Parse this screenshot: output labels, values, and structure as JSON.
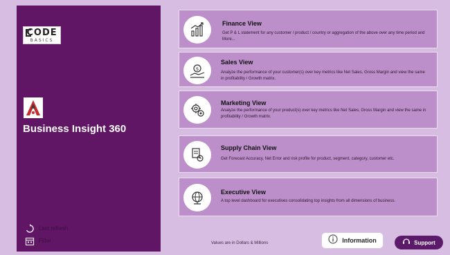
{
  "sidebar": {
    "brand_logo": {
      "top": "CODE",
      "bottom": "BASICS"
    },
    "app_title": "Business Insight 360",
    "rows": [
      {
        "icon": "refresh-icon",
        "label": "Last refresh"
      },
      {
        "icon": "calendar-icon",
        "label": "Filter"
      }
    ]
  },
  "cards": [
    {
      "title": "Finance View",
      "icon": "finance-chart-icon",
      "description": "Get P & L statement for any customer / product / country or aggregation of the above over any time period and More..."
    },
    {
      "title": "Sales View",
      "icon": "sales-money-icon",
      "description": "Analyze the performance of your customer(s) over key metrics like Net Sales, Gross Margin and view the same in profitability / Growth matrix."
    },
    {
      "title": "Marketing View",
      "icon": "marketing-gear-icon",
      "description": "Analyze the performance of your product(s) over key metrics like Net Sales, Gross Margin and view the same in profitability / Growth matrix."
    },
    {
      "title": "Supply Chain View",
      "icon": "supply-chain-icon",
      "description": "Get Forecast Accuracy, Net Error and risk profile for product, segment, category, customer etc."
    },
    {
      "title": "Executive View",
      "icon": "executive-globe-icon",
      "description": "A top level dashboard for executives consolidating top insights from all dimensions of business."
    }
  ],
  "footer": {
    "note": "Values are in Dollars & Millions",
    "info_button": "Information",
    "support_button": "Support"
  },
  "colors": {
    "page_bg": "#d8bde3",
    "sidebar_bg": "#601565",
    "card_bg": "#bd8fca",
    "support_bg": "#5c1a6a"
  }
}
